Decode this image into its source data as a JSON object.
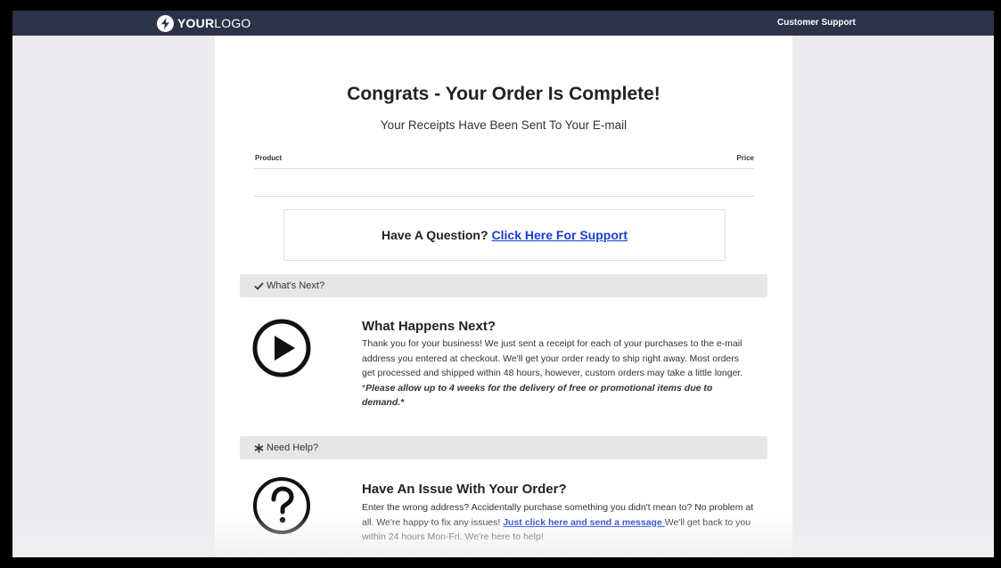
{
  "header": {
    "logo_bold": "YOUR",
    "logo_light": "LOGO",
    "support_link": "Customer Support"
  },
  "main": {
    "title": "Congrats - Your Order Is Complete!",
    "subtitle": "Your Receipts Have Been Sent To Your E-mail",
    "table": {
      "col_product": "Product",
      "col_price": "Price",
      "rows": []
    },
    "question": {
      "prefix": "Have A Question?",
      "link": "Click Here For Support"
    }
  },
  "sections": {
    "whats_next": {
      "bar_label": "What's Next?",
      "heading": "What Happens Next?",
      "text": "Thank you for your business! We just sent a receipt for each of your purchases to the e-mail address you entered at checkout. We'll get your order ready to ship right away. Most orders get processed and shipped within 48 hours, however, custom orders may take a little longer. *",
      "emphasis": "Please allow up to 4 weeks for the delivery of free or promotional items due to demand.*"
    },
    "need_help": {
      "bar_label": "Need Help?",
      "heading": "Have An Issue With Your Order?",
      "text": "Enter the wrong address? Accidentally purchase something you didn't mean to? No problem at all. We're happy to fix any issues! ",
      "link": "Just click here and send a message ",
      "text_after": "We'll get back to you within 24 hours Mon-Fri. We're here to help!"
    }
  },
  "icons": {
    "logo": "lightning-bolt-icon",
    "whats_next_bar": "checkmark-icon",
    "need_help_bar": "asterisk-icon",
    "whats_next_block": "play-circle-icon",
    "need_help_block": "question-circle-icon"
  },
  "colors": {
    "topbar": "#2c3349",
    "background": "#ebebef",
    "link": "#1a3cd8",
    "section_bar": "#e6e6e6"
  }
}
